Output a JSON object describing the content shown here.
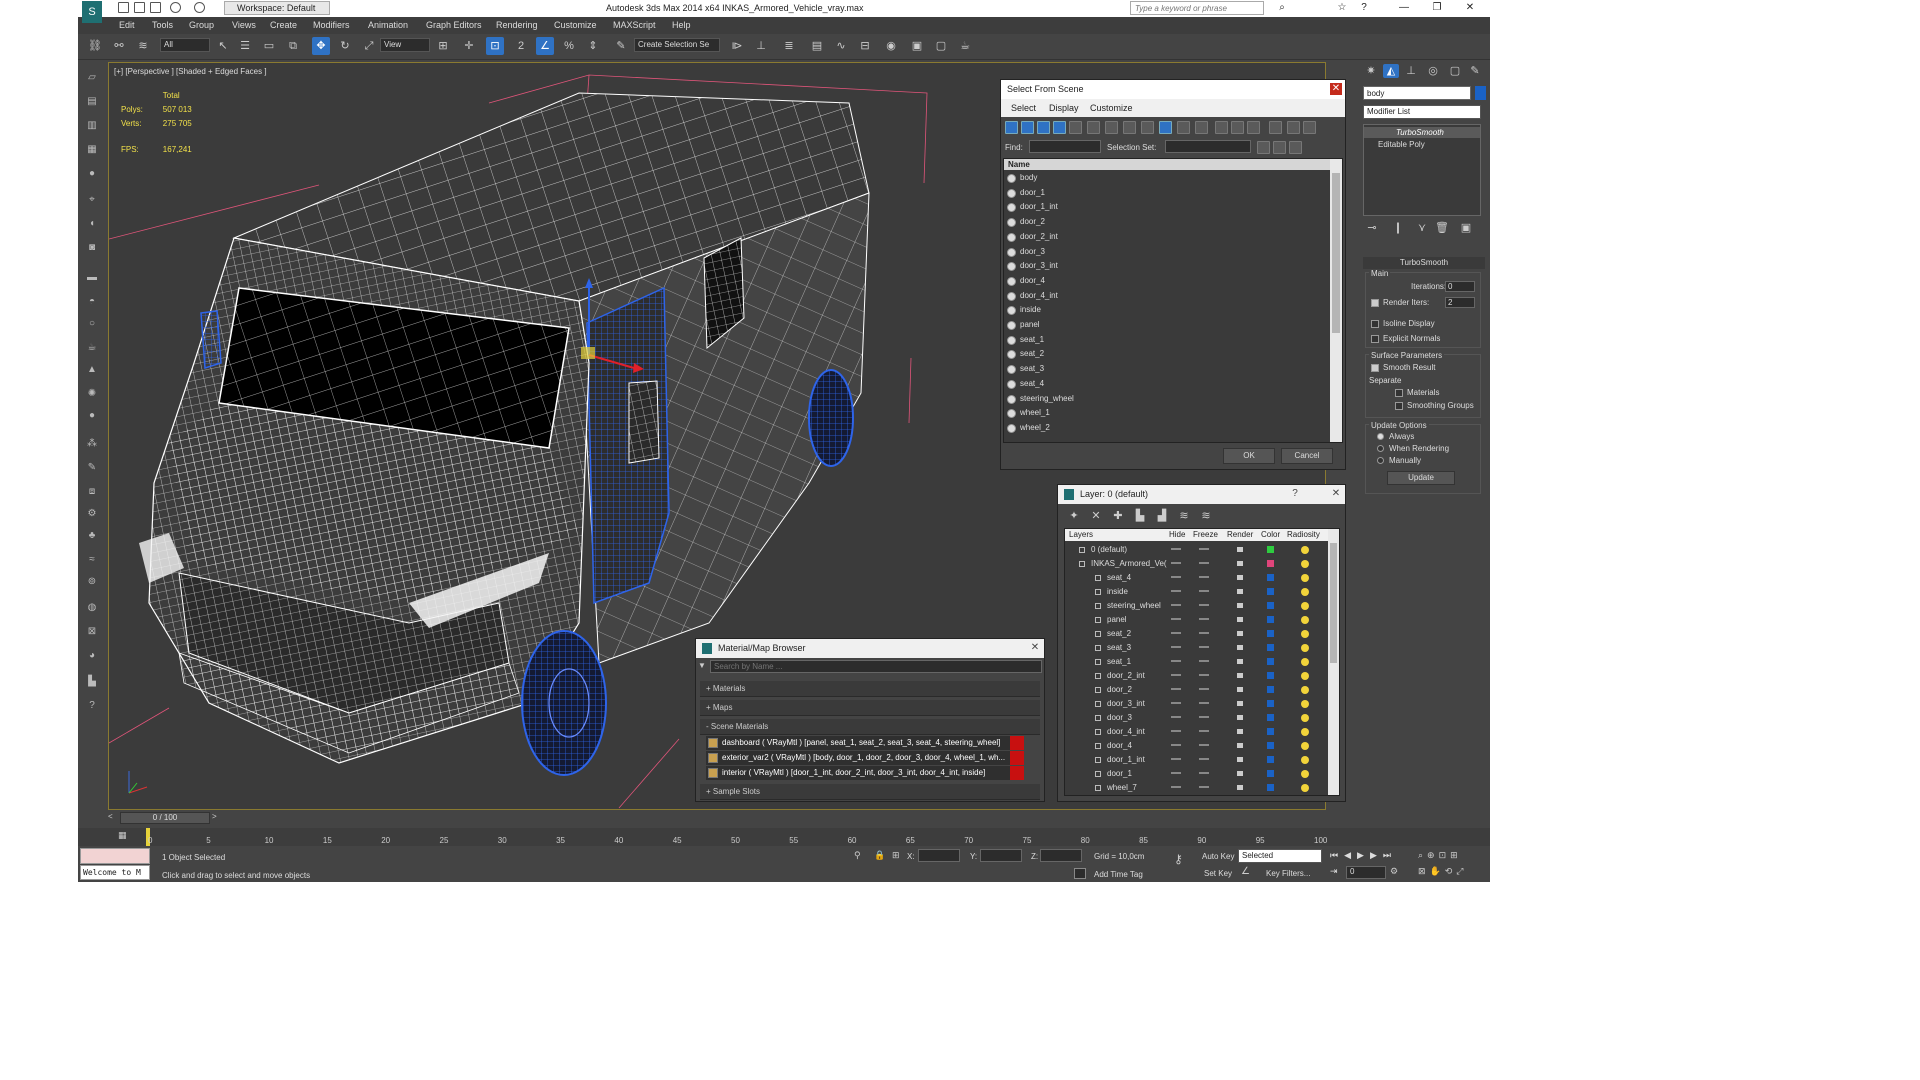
{
  "titlebar": {
    "workspace": "Workspace: Default",
    "title": "Autodesk 3ds Max  2014 x64    INKAS_Armored_Vehicle_vray.max",
    "search_placeholder": "Type a keyword or phrase"
  },
  "menu": [
    "Edit",
    "Tools",
    "Group",
    "Views",
    "Create",
    "Modifiers",
    "Animation",
    "Graph Editors",
    "Rendering",
    "Customize",
    "MAXScript",
    "Help"
  ],
  "toolbar": {
    "filter": "All",
    "refcoord": "View",
    "selset": "Create Selection Se"
  },
  "viewport": {
    "label": "[+] [Perspective ] [Shaded + Edged Faces ]",
    "stats": {
      "total": "Total",
      "polys_label": "Polys:",
      "polys": "507 013",
      "verts_label": "Verts:",
      "verts": "275 705",
      "fps_label": "FPS:",
      "fps": "167,241"
    }
  },
  "select_from_scene": {
    "title": "Select From Scene",
    "menu": [
      "Select",
      "Display",
      "Customize"
    ],
    "find_label": "Find:",
    "selset_label": "Selection Set:",
    "col_name": "Name",
    "objects": [
      "body",
      "door_1",
      "door_1_int",
      "door_2",
      "door_2_int",
      "door_3",
      "door_3_int",
      "door_4",
      "door_4_int",
      "inside",
      "panel",
      "seat_1",
      "seat_2",
      "seat_3",
      "seat_4",
      "steering_wheel",
      "wheel_1",
      "wheel_2"
    ],
    "ok": "OK",
    "cancel": "Cancel"
  },
  "layers": {
    "title": "Layer: 0 (default)",
    "cols": {
      "layers": "Layers",
      "hide": "Hide",
      "freeze": "Freeze",
      "render": "Render",
      "color": "Color",
      "radiosity": "Radiosity"
    },
    "rows": [
      {
        "name": "0 (default)",
        "color": "#2ecc40"
      },
      {
        "name": "INKAS_Armored_Ve(",
        "color": "#e0457b"
      },
      {
        "name": "seat_4"
      },
      {
        "name": "inside"
      },
      {
        "name": "steering_wheel"
      },
      {
        "name": "panel"
      },
      {
        "name": "seat_2"
      },
      {
        "name": "seat_3"
      },
      {
        "name": "seat_1"
      },
      {
        "name": "door_2_int"
      },
      {
        "name": "door_2"
      },
      {
        "name": "door_3_int"
      },
      {
        "name": "door_3"
      },
      {
        "name": "door_4_int"
      },
      {
        "name": "door_4"
      },
      {
        "name": "door_1_int"
      },
      {
        "name": "door_1"
      },
      {
        "name": "wheel_7"
      }
    ],
    "help": "?"
  },
  "material_browser": {
    "title": "Material/Map Browser",
    "search_placeholder": "Search by Name ...",
    "materials": "+ Materials",
    "maps": "+ Maps",
    "scene": "- Scene Materials",
    "items": [
      "dashboard  ( VRayMtl ) [panel, seat_1, seat_2, seat_3, seat_4, steering_wheel]",
      "exterior_var2  ( VRayMtl ) [body, door_1, door_2, door_3, door_4, wheel_1, wh...",
      "interior  ( VRayMtl ) [door_1_int, door_2_int, door_3_int, door_4_int, inside]"
    ],
    "slots": "+ Sample Slots"
  },
  "command_panel": {
    "object_name": "body",
    "modifier_list": "Modifier List",
    "stack": [
      "TurboSmooth",
      "Editable Poly"
    ],
    "rollout": "TurboSmooth",
    "main": "Main",
    "iterations_label": "Iterations:",
    "iterations": "0",
    "render_iters_label": "Render Iters:",
    "render_iters": "2",
    "isoline": "Isoline Display",
    "explicit": "Explicit Normals",
    "surface": "Surface Parameters",
    "smooth_result": "Smooth Result",
    "separate": "Separate",
    "materials": "Materials",
    "smoothing": "Smoothing Groups",
    "update_options": "Update Options",
    "always": "Always",
    "when_rendering": "When Rendering",
    "manually": "Manually",
    "update": "Update"
  },
  "timeline": {
    "frame": "0 / 100",
    "ticks": [
      "0",
      "5",
      "10",
      "15",
      "20",
      "25",
      "30",
      "35",
      "40",
      "45",
      "50",
      "55",
      "60",
      "65",
      "70",
      "75",
      "80",
      "85",
      "90",
      "95",
      "100"
    ]
  },
  "status": {
    "welcome": "Welcome to M",
    "selected": "1 Object Selected",
    "prompt": "Click and drag to select and move objects",
    "x": "X:",
    "y": "Y:",
    "z": "Z:",
    "grid": "Grid = 10,0cm",
    "add_time_tag": "Add Time Tag",
    "auto_key": "Auto Key",
    "set_key": "Set Key",
    "selected_dd": "Selected",
    "key_filters": "Key Filters...",
    "frame_field": "0"
  },
  "colors": {
    "accent": "#2f72c4",
    "wire": "#ffffff",
    "wire_blue": "#1d4fd8"
  }
}
